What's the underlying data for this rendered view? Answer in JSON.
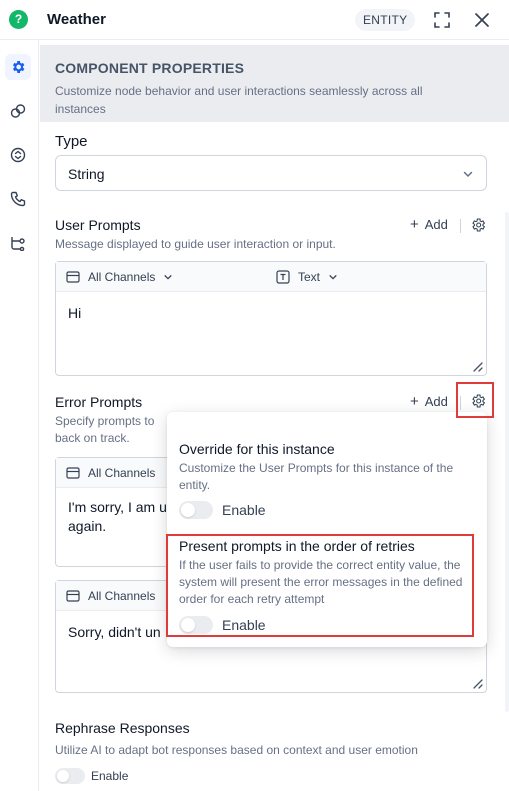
{
  "header": {
    "title": "Weather",
    "badge": "ENTITY"
  },
  "sidebar": {
    "items": [
      {
        "icon": "gear-icon",
        "active": true
      },
      {
        "icon": "link-icon",
        "active": false
      },
      {
        "icon": "sync-icon",
        "active": false
      },
      {
        "icon": "phone-icon",
        "active": false
      },
      {
        "icon": "flow-icon",
        "active": false
      }
    ]
  },
  "properties": {
    "title": "COMPONENT PROPERTIES",
    "description": "Customize node behavior and user interactions seamlessly across all instances"
  },
  "type_field": {
    "label": "Type",
    "value": "String"
  },
  "user_prompts": {
    "label": "User Prompts",
    "description": "Message displayed to guide user interaction or input.",
    "add_label": "Add",
    "channel": "All Channels",
    "format": "Text",
    "text": "Hi"
  },
  "error_prompts": {
    "label": "Error Prompts",
    "description_line1": "Specify prompts to",
    "description_line2": "back on track.",
    "add_label": "Add",
    "items": [
      {
        "channel": "All Channels",
        "text_line1": "I'm sorry, I am u",
        "text_line2": "again."
      },
      {
        "channel": "All Channels",
        "text_line1": "Sorry, didn't un",
        "text_line2": ""
      }
    ]
  },
  "rephrase": {
    "label": "Rephrase Responses",
    "description": "Utilize AI to adapt bot responses based on context and user emotion",
    "toggle_label": "Enable",
    "enabled": false
  },
  "popover": {
    "override_title": "Override for this instance",
    "override_desc": "Customize the User Prompts for this instance of the entity.",
    "override_toggle_label": "Enable",
    "override_enabled": false,
    "order_title": "Present prompts in the order of retries",
    "order_desc": "If the user fails to provide the correct entity value, the system will present the error messages in the defined order for each retry attempt",
    "order_toggle_label": "Enable",
    "order_enabled": false
  },
  "colors": {
    "accent": "#155eef",
    "brand": "#12b76a",
    "highlight": "#e03a3a"
  }
}
